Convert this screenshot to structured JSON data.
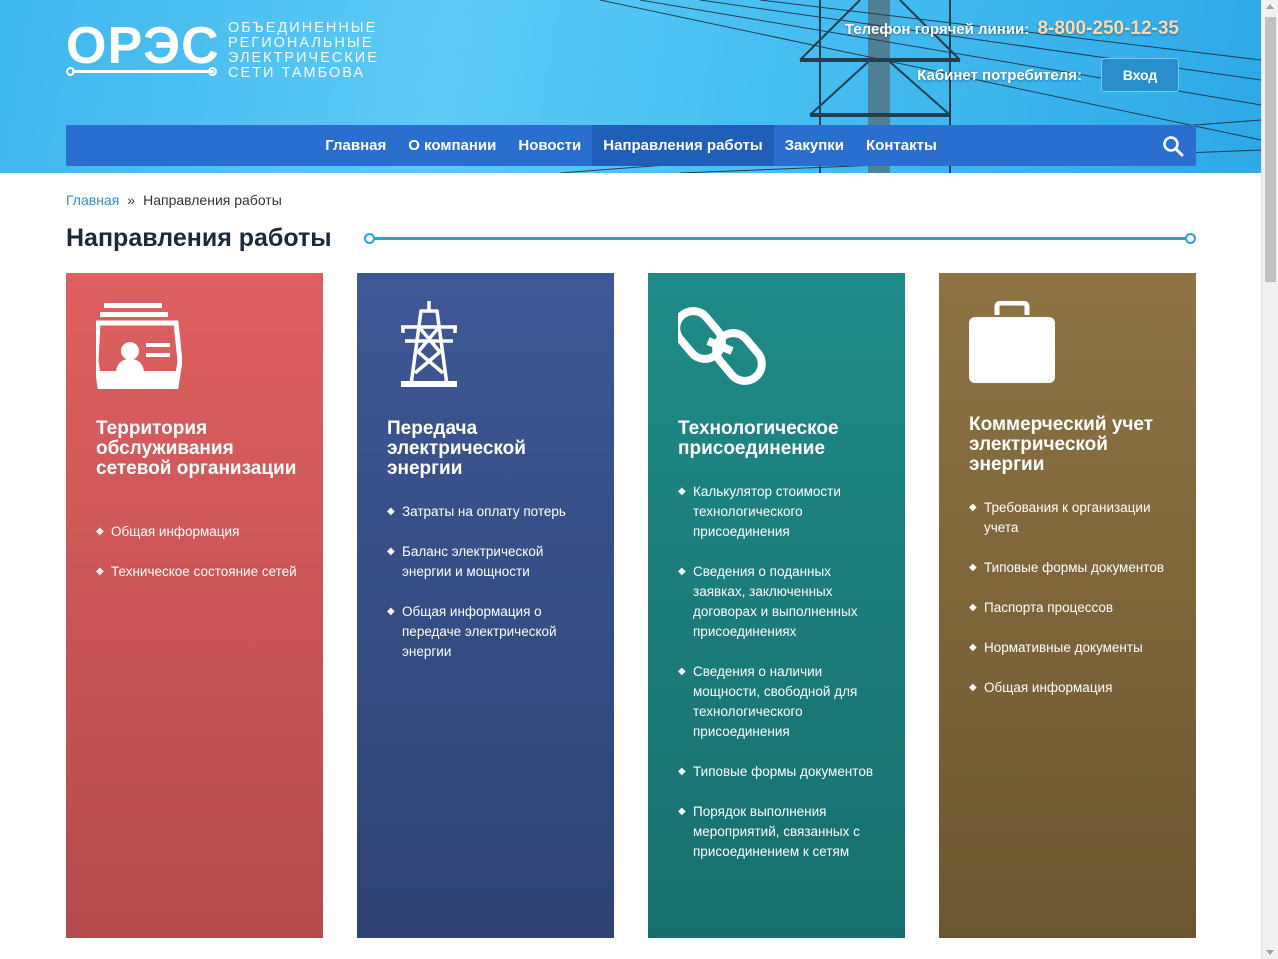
{
  "logo": {
    "mark": "ОРЭС",
    "sub_lines": [
      "ОБЪЕДИНЕННЫЕ",
      "РЕГИОНАЛЬНЫЕ",
      "ЭЛЕКТРИЧЕСКИЕ",
      "СЕТИ ТАМБОВА"
    ]
  },
  "header": {
    "hotline_label": "Телефон горячей линии:",
    "hotline_phone": "8-800-250-12-35",
    "cabinet_label": "Кабинет потребителя:",
    "login_label": "Вход"
  },
  "nav": {
    "items": [
      {
        "label": "Главная"
      },
      {
        "label": "О компании"
      },
      {
        "label": "Новости"
      },
      {
        "label": "Направления работы"
      },
      {
        "label": "Закупки"
      },
      {
        "label": "Контакты"
      }
    ],
    "active_index": 3
  },
  "breadcrumb": {
    "home": "Главная",
    "separator": "»",
    "current": "Направления работы"
  },
  "page_title": "Направления работы",
  "cards": [
    {
      "title": "Территория обслуживания сетевой организации",
      "icon": "id-card-icon",
      "color": "#df6060",
      "items": [
        "Общая информация",
        "Техническое состояние сетей"
      ]
    },
    {
      "title": "Передача электрической энергии",
      "icon": "power-tower-icon",
      "color": "#3e5896",
      "items": [
        "Затраты на оплату потерь",
        "Баланс электрической энергии и мощности",
        "Общая информация о передаче электрической энергии"
      ]
    },
    {
      "title": "Технологическое присоединение",
      "icon": "chain-link-icon",
      "color": "#1f8b88",
      "items": [
        "Калькулятор стоимости технологического присоединения",
        "Сведения о поданных заявках, заключенных договорах и выполненных присоединениях",
        "Сведения о наличии мощности, свободной для технологического присоединения",
        "Типовые формы документов",
        "Порядок выполнения мероприятий, связанных с присоединением к сетям"
      ]
    },
    {
      "title": "Коммерческий учет электрической энергии",
      "icon": "briefcase-icon",
      "color": "#8e7444",
      "items": [
        "Требования к организации учета",
        "Типовые формы документов",
        "Паспорта процессов",
        "Нормативные документы",
        "Общая информация"
      ]
    }
  ]
}
